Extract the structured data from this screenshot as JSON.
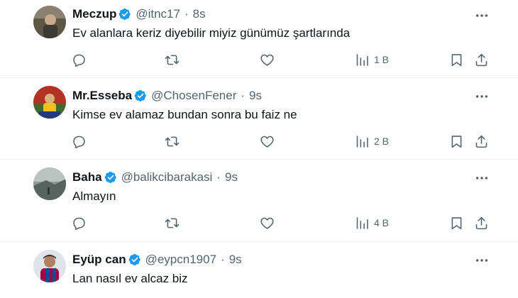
{
  "tweets": [
    {
      "name": "Meczup",
      "handle": "@itnc17",
      "separator": "·",
      "time": "8s",
      "text": "Ev alanlara keriz diyebilir miyiz günümüz şartlarında",
      "views": "1 B",
      "avatar_icon": "profile-photo"
    },
    {
      "name": "Mr.Esseba",
      "handle": "@ChosenFener",
      "separator": "·",
      "time": "9s",
      "text": "Kimse ev alamaz bundan sonra bu faiz ne",
      "views": "2 B",
      "avatar_icon": "profile-photo"
    },
    {
      "name": "Baha",
      "handle": "@balikcibarakasi",
      "separator": "·",
      "time": "9s",
      "text": "Almayın",
      "views": "4 B",
      "avatar_icon": "profile-photo"
    },
    {
      "name": "Eyüp can",
      "handle": "@eypcn1907",
      "separator": "·",
      "time": "9s",
      "text": "Lan nasıl ev alcaz biz",
      "avatar_icon": "profile-photo"
    }
  ],
  "colors": {
    "verified_badge": "#1d9bf0",
    "secondary_text": "#536471",
    "divider": "#eff3f4"
  },
  "icons": [
    "verified-badge-icon",
    "more-icon",
    "reply-icon",
    "retweet-icon",
    "like-icon",
    "views-icon",
    "bookmark-icon",
    "share-icon"
  ]
}
